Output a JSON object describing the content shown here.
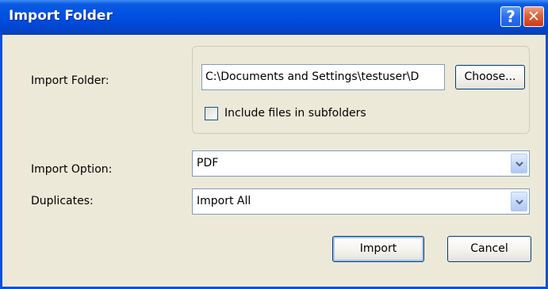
{
  "window": {
    "title": "Import Folder",
    "help_glyph": "?",
    "close_glyph": "✕"
  },
  "folder": {
    "label": "Import Folder:",
    "path_value": "C:\\Documents and Settings\\testuser\\D",
    "choose_label": "Choose...",
    "include_subfolders_label": "Include files in subfolders",
    "include_subfolders_checked": false
  },
  "import_option": {
    "label": "Import Option:",
    "selected": "PDF"
  },
  "duplicates": {
    "label": "Duplicates:",
    "selected": "Import All"
  },
  "actions": {
    "import_label": "Import",
    "cancel_label": "Cancel"
  },
  "colors": {
    "titlebar": "#0050e2",
    "dialog_bg": "#ece9d8",
    "field_border": "#7f9db9",
    "close_button": "#e0603a"
  },
  "icons": {
    "dropdown": "chevron-down-icon",
    "help": "help-icon",
    "close": "close-icon"
  }
}
